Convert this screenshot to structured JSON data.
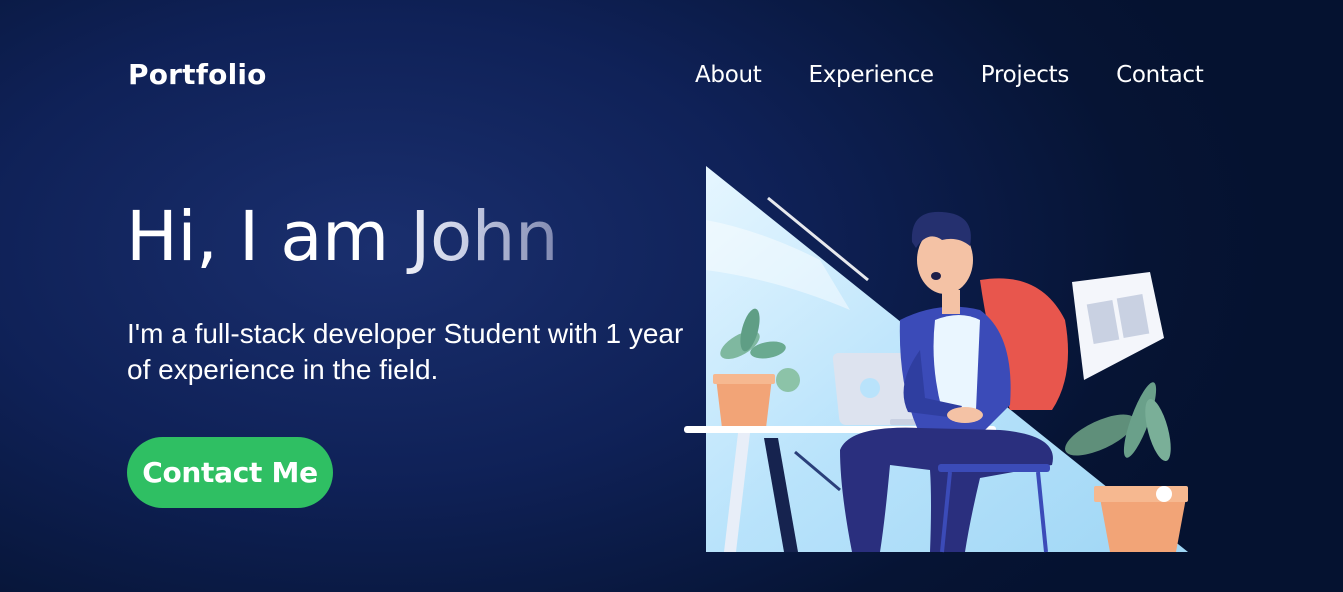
{
  "header": {
    "brand": "Portfolio",
    "nav": [
      "About",
      "Experience",
      "Projects",
      "Contact"
    ]
  },
  "hero": {
    "title": "Hi, I am John",
    "subtitle": "I'm a full-stack developer Student with 1 year of experience in the field.",
    "cta_label": "Contact Me"
  },
  "colors": {
    "background": "#0f2157",
    "accent": "#2fbf63",
    "text": "#ffffff"
  },
  "illustration": {
    "icon": "developer-with-laptop-illustration"
  }
}
